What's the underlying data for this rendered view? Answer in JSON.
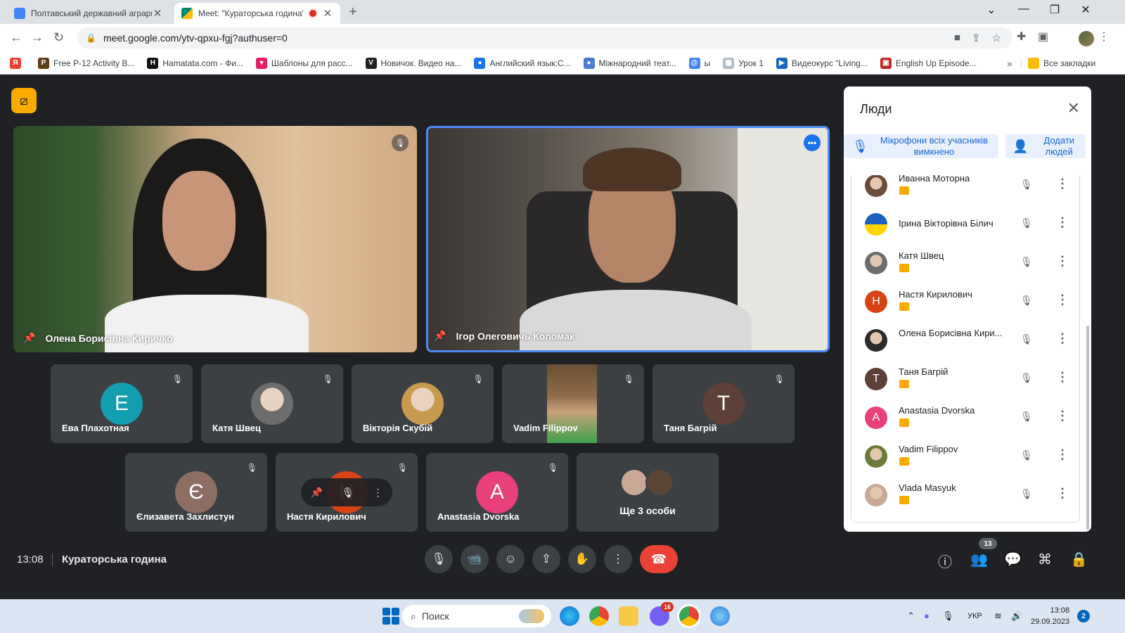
{
  "browser": {
    "tabs": [
      {
        "title": "Полтавський державний аграрний",
        "favicon_color": "#4285f4",
        "active": false
      },
      {
        "title": "Meet: \"Кураторська година\"",
        "favicon_color": "#00897b",
        "active": true,
        "recording": true
      }
    ],
    "url": "meet.google.com/ytv-qpxu-fgj?authuser=0",
    "bookmarks": [
      {
        "label": "",
        "icon_color": "#ea4335",
        "icon": "Я"
      },
      {
        "label": "Free P-12 Activity B...",
        "icon_color": "#5f3c1a",
        "icon": "P"
      },
      {
        "label": "Hamatata.com - Фи...",
        "icon_color": "#111111",
        "icon": "H"
      },
      {
        "label": "Шаблоны для расс...",
        "icon_color": "#e91e63",
        "icon": "♥"
      },
      {
        "label": "Новичок. Видео на...",
        "icon_color": "#202124",
        "icon": "V"
      },
      {
        "label": "Английский язык:С...",
        "icon_color": "#1a73e8",
        "icon": "●"
      },
      {
        "label": "Міжнародний теат...",
        "icon_color": "#4a7bd0",
        "icon": "●"
      },
      {
        "label": "ы",
        "icon_color": "#4285f4",
        "icon": "@"
      },
      {
        "label": "Урок 1",
        "icon_color": "#b0bec5",
        "icon": "▦"
      },
      {
        "label": "Видеокурс \"Living...",
        "icon_color": "#1565c0",
        "icon": "▶"
      },
      {
        "label": "English Up Episode...",
        "icon_color": "#c62828",
        "icon": "▣"
      }
    ],
    "bookmarks_overflow": "»",
    "all_bookmarks": "Все закладки"
  },
  "meet": {
    "big_tiles": [
      {
        "name": "Олена Борисівна Киричко"
      },
      {
        "name": "Ігор Олеговичь Коломак"
      }
    ],
    "small_tiles": [
      {
        "name": "Ева Плахотная",
        "initial": "Е",
        "color": "#129eaf",
        "kind": "initial"
      },
      {
        "name": "Катя Швец",
        "initial": "",
        "color": "#6d6d6d",
        "kind": "photo"
      },
      {
        "name": "Вікторія Скубій",
        "initial": "",
        "color": "#c89a4d",
        "kind": "photo"
      },
      {
        "name": "Vadim Filippov",
        "initial": "",
        "color": "#3fa14f",
        "kind": "video"
      },
      {
        "name": "Таня Багрій",
        "initial": "Т",
        "color": "#5d4037",
        "kind": "initial"
      },
      {
        "name": "Єлизавета Захлистун",
        "initial": "Є",
        "color": "#8d6e63",
        "kind": "initial"
      },
      {
        "name": "Настя Кирилович",
        "initial": "Н",
        "color": "#d84315",
        "kind": "hover"
      },
      {
        "name": "Anastasia Dvorska",
        "initial": "A",
        "color": "#e8407a",
        "kind": "initial"
      }
    ],
    "more_people": {
      "label": "Ще 3 особи"
    },
    "time": "13:08",
    "meeting_name": "Кураторська година",
    "participant_count": "13"
  },
  "people_panel": {
    "title": "Люди",
    "mute_all_label": "Мікрофони всіх учасників вимкнено",
    "add_people_label": "Додати людей",
    "participants": [
      {
        "name": "Иванна Моторна",
        "avatar": "photo",
        "color": "#6b4b3a",
        "initial": ""
      },
      {
        "name": "Ірина Вікторівна Білич",
        "avatar": "flag",
        "color": "#ffd500",
        "initial": ""
      },
      {
        "name": "Катя Швец",
        "avatar": "photo",
        "color": "#6d6d6d",
        "initial": ""
      },
      {
        "name": "Настя Кирилович",
        "avatar": "initial",
        "color": "#d84315",
        "initial": "Н"
      },
      {
        "name": "Олена Борисівна Кири...",
        "avatar": "photo",
        "color": "#2b2b2b",
        "initial": ""
      },
      {
        "name": "Таня Багрій",
        "avatar": "initial",
        "color": "#5d4037",
        "initial": "Т"
      },
      {
        "name": "Anastasia Dvorska",
        "avatar": "initial",
        "color": "#e8407a",
        "initial": "A"
      },
      {
        "name": "Vadim Filippov",
        "avatar": "photo",
        "color": "#6b7a3a",
        "initial": ""
      },
      {
        "name": "Vlada Masyuk",
        "avatar": "photo",
        "color": "#c9a896",
        "initial": ""
      }
    ]
  },
  "taskbar": {
    "search_placeholder": "Поиск",
    "viber_badge": "16",
    "language": "УКР",
    "time": "13:08",
    "date": "29.09.2023",
    "notifications": "2"
  },
  "colors": {
    "meet_bg": "#202124",
    "accent_blue": "#1a73e8",
    "hangup_red": "#ea4335",
    "recording_badge": "#f9ab00"
  }
}
